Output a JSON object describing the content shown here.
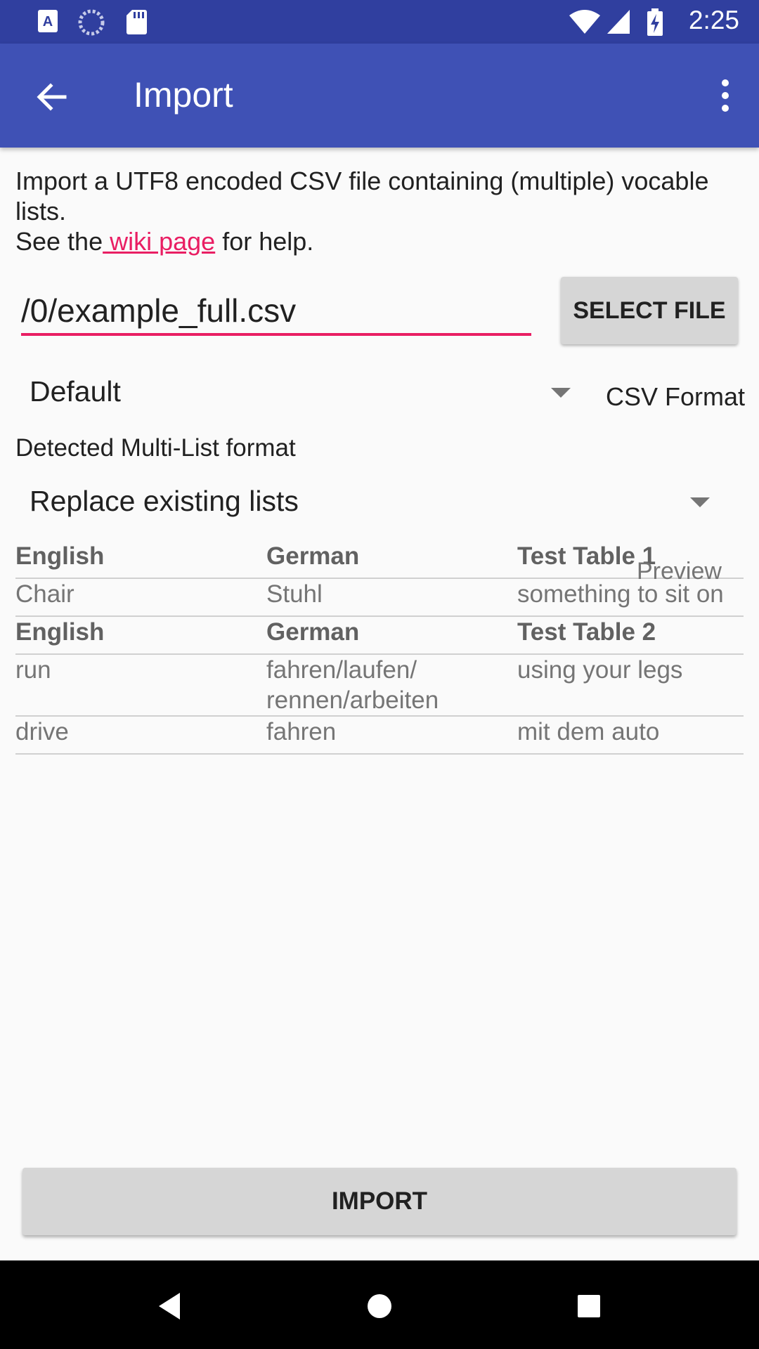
{
  "status_bar": {
    "time": "2:25",
    "left_icons": [
      "a11y-icon",
      "sync-icon",
      "sd-card-icon"
    ],
    "right_icons": [
      "wifi-icon",
      "signal-icon",
      "battery-charging-icon"
    ]
  },
  "app_bar": {
    "title": "Import",
    "back_icon": "arrow-back-icon",
    "menu_icon": "more-vert-icon",
    "color": "#3f51b5",
    "status_color": "#303f9f"
  },
  "intro": {
    "line1": "Import a UTF8 encoded CSV file containing (multiple) vocable lists.",
    "see_prefix": "See the",
    "wiki_link": " wiki page",
    "see_suffix": " for help.",
    "link_color": "#e91e63"
  },
  "file": {
    "path_value": "/0/example_full.csv",
    "select_button": "SELECT FILE"
  },
  "csv_format": {
    "selected": "Default",
    "label": "CSV Format"
  },
  "detected_text": "Detected Multi-List format",
  "import_mode": {
    "selected": "Replace existing lists"
  },
  "preview": {
    "label": "Preview",
    "rows": [
      {
        "header": true,
        "cells": [
          "English",
          "German",
          "Test Table 1"
        ]
      },
      {
        "header": false,
        "cells": [
          "Chair",
          "Stuhl",
          "something to sit on"
        ]
      },
      {
        "header": true,
        "cells": [
          "English",
          "German",
          "Test Table 2"
        ]
      },
      {
        "header": false,
        "cells": [
          "run",
          "fahren/laufen/\nrennen/arbeiten",
          "using your legs"
        ]
      },
      {
        "header": false,
        "cells": [
          "drive",
          "fahren",
          "mit dem auto"
        ]
      }
    ]
  },
  "import_button": "IMPORT",
  "nav_bar": {
    "icons": [
      "nav-back-icon",
      "nav-home-icon",
      "nav-recents-icon"
    ]
  }
}
